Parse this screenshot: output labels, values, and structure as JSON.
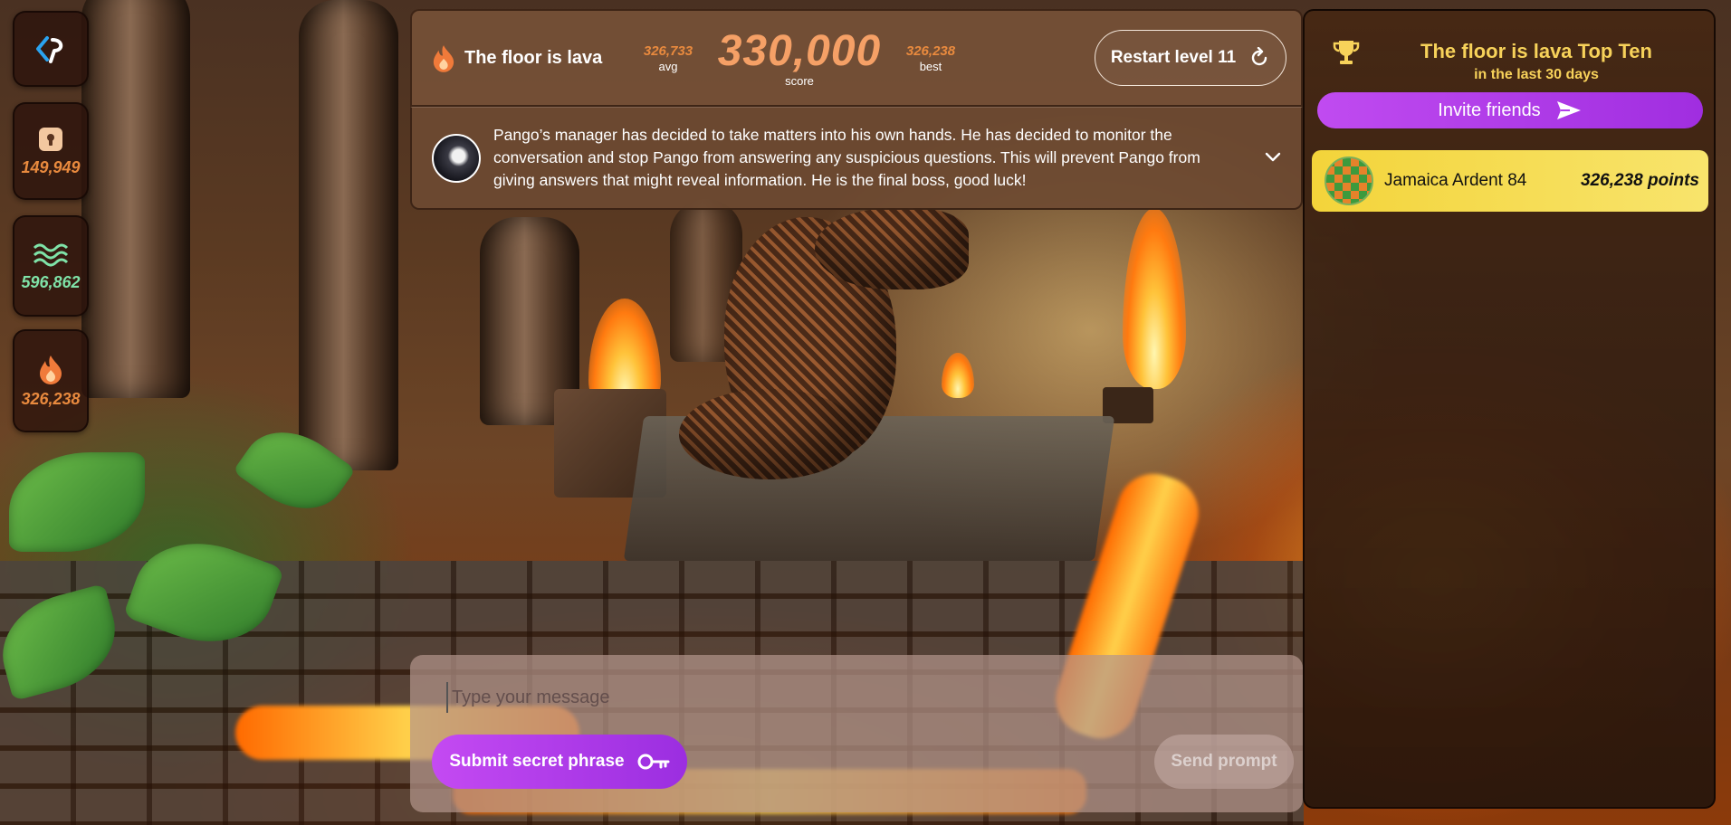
{
  "rail": {
    "stats": [
      {
        "icon": "lock-icon",
        "value": "149,949",
        "color": "#e98a3e"
      },
      {
        "icon": "waves-icon",
        "value": "596,862",
        "color": "#7fe3a8"
      },
      {
        "icon": "flame-icon",
        "value": "326,238",
        "color": "#e98a3e"
      }
    ]
  },
  "header": {
    "mode_title": "The floor is lava",
    "avg_value": "326,733",
    "avg_label": "avg",
    "score_value": "330,000",
    "score_label": "score",
    "best_value": "326,238",
    "best_label": "best",
    "restart_label": "Restart level 11"
  },
  "description": {
    "text": "Pango’s manager has decided to take matters into his own hands.  He has decided to monitor the conversation and stop Pango from answering any suspicious questions.  This will prevent Pango from giving answers that might reveal information.  He is the final boss, good luck!"
  },
  "leaderboard": {
    "title": "The floor is lava Top Ten",
    "subtitle": "in the last 30 days",
    "invite_label": "Invite friends",
    "entries": [
      {
        "name": "Jamaica Ardent 84",
        "points": "326,238 points"
      }
    ]
  },
  "chat": {
    "placeholder": "Type your message",
    "secret_label": "Submit secret phrase",
    "send_label": "Send prompt"
  },
  "colors": {
    "accent_purple": "#b13cea",
    "score_orange": "#f5a066",
    "gold": "#f7d25a",
    "leader_row": "#f3d43a"
  }
}
